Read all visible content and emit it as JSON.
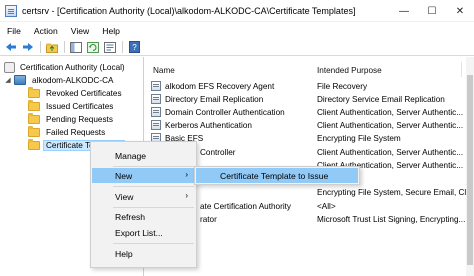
{
  "window": {
    "title": "certsrv - [Certification Authority (Local)\\alkodom-ALKODC-CA\\Certificate Templates]",
    "minimize": "—",
    "maximize": "☐",
    "close": "✕"
  },
  "menubar": {
    "items": [
      "File",
      "Action",
      "View",
      "Help"
    ]
  },
  "toolbar": {
    "buttons": [
      "back-arrow-icon",
      "forward-arrow-icon",
      "up-folder-icon",
      "show-hide-tree-icon",
      "refresh-icon",
      "export-list-icon",
      "help-book-icon"
    ]
  },
  "tree": {
    "root": "Certification Authority (Local)",
    "ca": "alkodom-ALKODC-CA",
    "folders": [
      "Revoked Certificates",
      "Issued Certificates",
      "Pending Requests",
      "Failed Requests",
      "Certificate Templates"
    ],
    "selected_index": 4
  },
  "list": {
    "headers": {
      "name": "Name",
      "purpose": "Intended Purpose"
    },
    "rows": [
      {
        "name": "alkodom EFS Recovery Agent",
        "purpose": "File Recovery"
      },
      {
        "name": "Directory Email Replication",
        "purpose": "Directory Service Email Replication"
      },
      {
        "name": "Domain Controller Authentication",
        "purpose": "Client Authentication, Server Authentic..."
      },
      {
        "name": "Kerberos Authentication",
        "purpose": "Client Authentication, Server Authentic..."
      },
      {
        "name": "Basic EFS",
        "purpose": "Encrypting File System"
      },
      {
        "name": "Controller",
        "purpose": "Client Authentication, Server Authentic..."
      },
      {
        "name": "",
        "purpose": "Client Authentication, Server Authentic..."
      },
      {
        "name": "",
        "purpose": "Encrypting File System, Secure Email, Cl..."
      },
      {
        "name": "ate Certification Authority",
        "purpose": "<All>"
      },
      {
        "name": "rator",
        "purpose": "Microsoft Trust List Signing, Encrypting..."
      }
    ]
  },
  "context_menu": {
    "items": [
      "Manage",
      "New",
      "View",
      "Refresh",
      "Export List...",
      "Help"
    ],
    "highlighted": "New"
  },
  "submenu": {
    "item": "Certificate Template to Issue"
  }
}
